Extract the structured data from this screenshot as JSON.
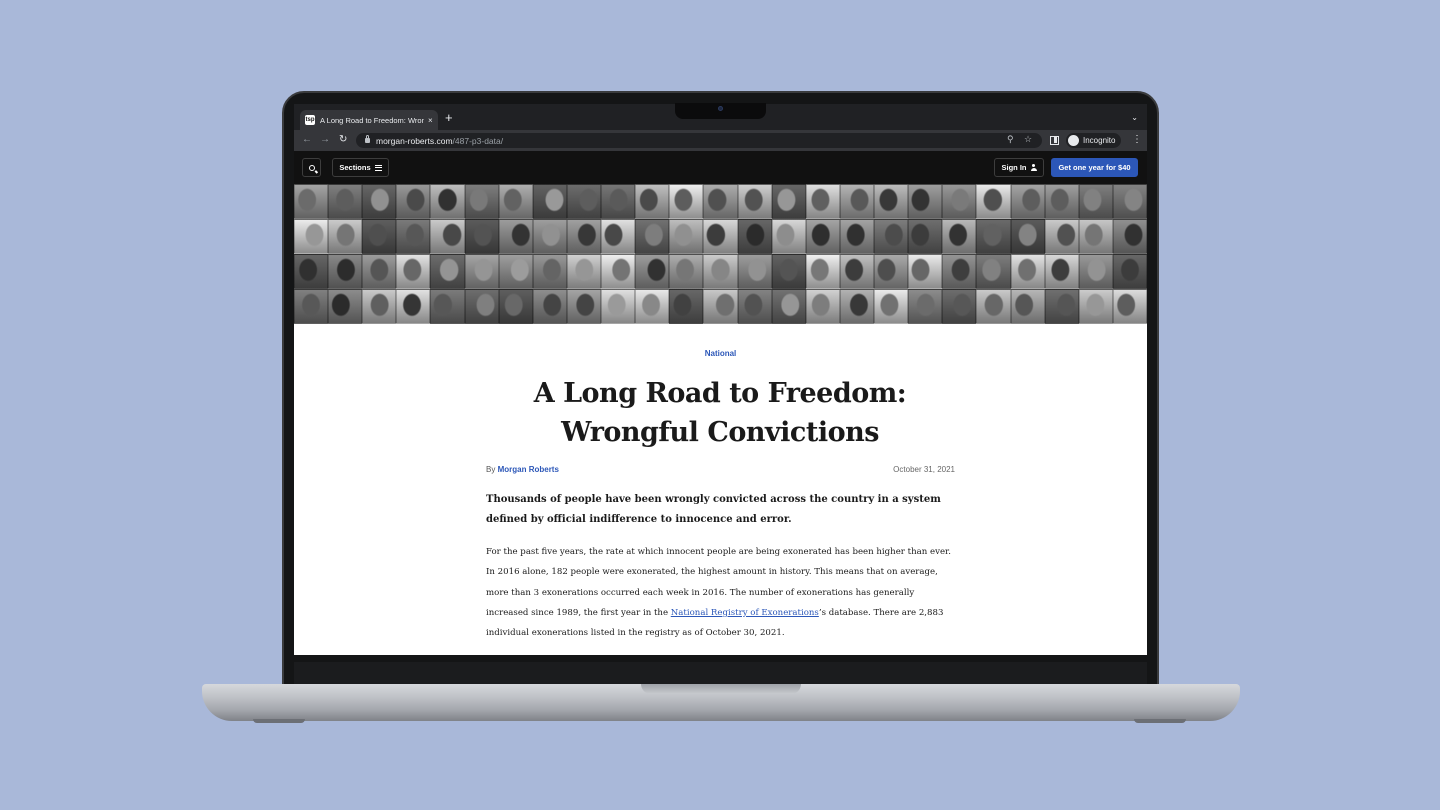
{
  "browser": {
    "tab_favicon": "tsp",
    "tab_title": "A Long Road to Freedom: Wrongful Convictions",
    "tab_close": "×",
    "new_tab": "+",
    "url_host": "morgan-roberts.com",
    "url_path": "/487-p3-data/",
    "profile_label": "Incognito",
    "icons": [
      "back-icon",
      "forward-icon",
      "reload-icon",
      "lock-icon",
      "zoom-icon",
      "star-icon",
      "side-panel-icon",
      "incognito-icon",
      "menu-icon"
    ]
  },
  "site_header": {
    "sections_label": "Sections",
    "signin_label": "Sign In",
    "subscribe_label": "Get one year for $40"
  },
  "hero": {
    "alt": "Grid of black-and-white portrait photos",
    "tile_count": 100
  },
  "article": {
    "kicker": "National",
    "headline_line1": "A Long Road to Freedom:",
    "headline_line2": "Wrongful Convictions",
    "byline_prefix": "By",
    "author": "Morgan Roberts",
    "date": "October 31, 2021",
    "dek": "Thousands of people have been wrongly convicted across the country in a system defined by official indifference to innocence and error.",
    "body_before_link": "For the past five years, the rate at which innocent people are being exonerated has been higher than ever. In 2016 alone, 182 people were exonerated, the highest amount in history. This means that on average, more than 3 exonerations occurred each week in 2016. The number of exonerations has generally increased since 1989, the first year in the ",
    "body_link": "National Registry of Exonerations",
    "body_after_link": "’s database. There are 2,883 individual exonerations listed in the registry as of October 30, 2021."
  },
  "colors": {
    "backdrop": "#a9b8d9",
    "accent": "#2c57b8",
    "header": "#111111"
  }
}
